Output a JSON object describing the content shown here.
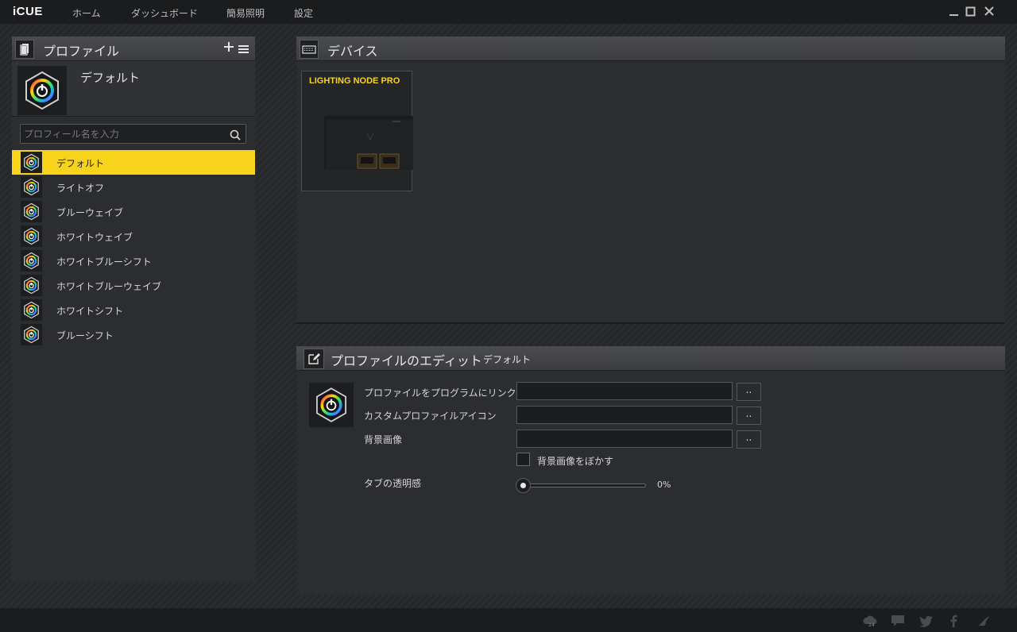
{
  "app": {
    "logo": "iCUE",
    "nav": [
      "ホーム",
      "ダッシュボード",
      "簡易照明",
      "設定"
    ]
  },
  "profiles": {
    "header_title": "プロファイル",
    "current_name": "デフォルト",
    "search_placeholder": "プロフィール名を入力",
    "items": [
      "デフォルト",
      "ライトオフ",
      "ブルーウェイブ",
      "ホワイトウェイブ",
      "ホワイトブルーシフト",
      "ホワイトブルーウェイブ",
      "ホワイトシフト",
      "ブルーシフト"
    ],
    "active_index": 0
  },
  "devices": {
    "header_title": "デバイス",
    "items": [
      {
        "name": "LIGHTING NODE PRO"
      }
    ]
  },
  "edit": {
    "header_title": "プロファイルのエディット",
    "profile_name": "デフォルト",
    "link_program_label": "プロファイルをプログラムにリンク",
    "custom_icon_label": "カスタムプロファイルアイコン",
    "background_image_label": "背景画像",
    "browse_label": "..",
    "blur_label": "背景画像をぼかす",
    "blur_checked": false,
    "transparency_label": "タブの透明感",
    "transparency_value": "0%",
    "link_program_value": "",
    "custom_icon_value": "",
    "background_image_value": ""
  },
  "footer": {
    "icons": [
      "cloud-icon",
      "chat-icon",
      "twitter-icon",
      "facebook-icon",
      "corsair-sails-icon"
    ],
    "cloud_badge": "24"
  },
  "colors": {
    "accent": "#f7d41b",
    "background": "#252628",
    "panel": "#2c2d30"
  }
}
